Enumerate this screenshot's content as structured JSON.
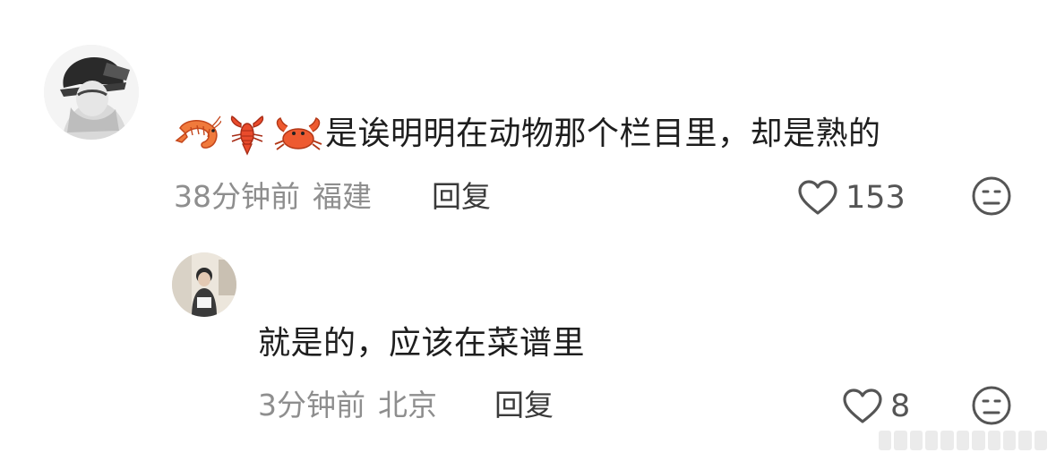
{
  "comments": [
    {
      "text": "是诶明明在动物那个栏目里，却是熟的",
      "time": "38分钟前",
      "location": "福建",
      "reply_label": "回复",
      "like_count": "153",
      "emojis": [
        "shrimp-icon",
        "lobster-icon",
        "crab-icon"
      ]
    }
  ],
  "replies": [
    {
      "text": "就是的，应该在菜谱里",
      "time": "3分钟前",
      "location": "北京",
      "reply_label": "回复",
      "like_count": "8"
    }
  ],
  "colors": {
    "text": "#1e1e1e",
    "meta": "#8e8e8e",
    "icon": "#555555",
    "emoji": "#e8643a"
  }
}
